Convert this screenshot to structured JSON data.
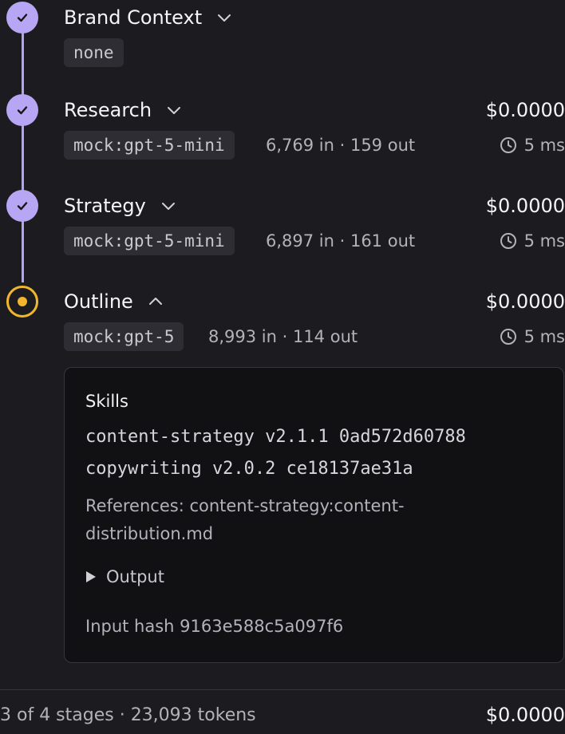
{
  "stages": [
    {
      "name": "Brand Context",
      "status": "done",
      "expanded": false,
      "model": "none"
    },
    {
      "name": "Research",
      "status": "done",
      "expanded": false,
      "model": "mock:gpt-5-mini",
      "tokens": "6,769 in · 159 out",
      "cost": "$0.0000",
      "duration": "5 ms"
    },
    {
      "name": "Strategy",
      "status": "done",
      "expanded": false,
      "model": "mock:gpt-5-mini",
      "tokens": "6,897 in · 161 out",
      "cost": "$0.0000",
      "duration": "5 ms"
    },
    {
      "name": "Outline",
      "status": "active",
      "expanded": true,
      "model": "mock:gpt-5",
      "tokens": "8,993 in · 114 out",
      "cost": "$0.0000",
      "duration": "5 ms"
    }
  ],
  "detail": {
    "skills_heading": "Skills",
    "skills": [
      "content-strategy v2.1.1 0ad572d60788",
      "copywriting v2.0.2 ce18137ae31a"
    ],
    "references": "References: content-strategy:content-distribution.md",
    "output_label": "Output",
    "input_hash": "Input hash 9163e588c5a097f6"
  },
  "footer": {
    "summary": "3 of 4 stages · 23,093 tokens",
    "total_cost": "$0.0000"
  },
  "colors": {
    "done": "#b7a6f4",
    "active": "#f2b52e",
    "background": "#1c1c20"
  },
  "icons": {
    "done": "check-icon",
    "active": "dot-icon",
    "collapsed": "chevron-down-icon",
    "expanded": "chevron-up-icon",
    "duration": "clock-icon",
    "output": "triangle-right-icon"
  }
}
